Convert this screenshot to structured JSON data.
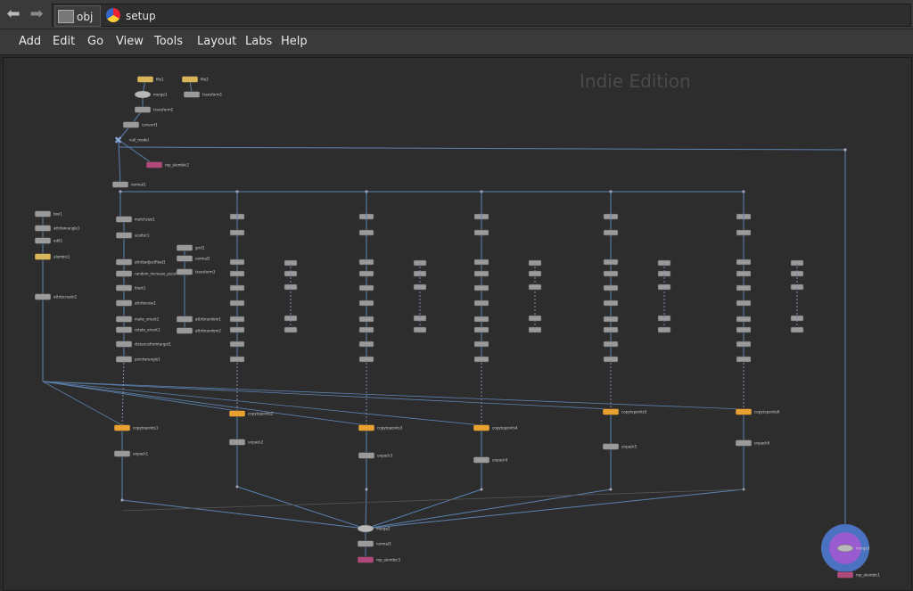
{
  "pathbar": {
    "back_icon": "left-arrow-icon",
    "forward_icon": "right-arrow-icon",
    "crumbs": [
      {
        "label": "obj",
        "icon": "object-network-icon"
      },
      {
        "label": "setup",
        "icon": "geometry-object-icon"
      }
    ]
  },
  "menu": [
    "Add",
    "Edit",
    "Go",
    "View",
    "Tools",
    "Layout",
    "Labs",
    "Help"
  ],
  "network": {
    "watermark": "Indie Edition",
    "colors": {
      "wire": "#5b82b0",
      "node": "#9a9a9a",
      "file": "#d8b45a",
      "copy": "#e8a030",
      "rop": "#b04a7a",
      "highlight": "#4a72c0",
      "merge_glow": "#9a5ad0"
    },
    "nodes": [
      {
        "name": "file1",
        "kind": "file"
      },
      {
        "name": "file2",
        "kind": "file"
      },
      {
        "name": "merge1",
        "kind": "merge"
      },
      {
        "name": "transform1",
        "kind": "sop"
      },
      {
        "name": "transform2",
        "kind": "sop"
      },
      {
        "name": "convert1",
        "kind": "sop"
      },
      {
        "name": "null_model",
        "kind": "null"
      },
      {
        "name": "rop_alembic2",
        "kind": "rop"
      },
      {
        "name": "normal1",
        "kind": "sop"
      },
      {
        "name": "box1",
        "kind": "sop"
      },
      {
        "name": "attribwrangle1",
        "kind": "sop"
      },
      {
        "name": "edit1",
        "kind": "sop"
      },
      {
        "name": "alembic1",
        "kind": "file"
      },
      {
        "name": "attribcreate1",
        "kind": "sop"
      },
      {
        "name": "matchsize1",
        "kind": "sop"
      },
      {
        "name": "scatter1",
        "kind": "sop"
      },
      {
        "name": "attribadjustfloat1",
        "kind": "sop"
      },
      {
        "name": "random_increase_pscale1",
        "kind": "sop"
      },
      {
        "name": "blast1",
        "kind": "sop"
      },
      {
        "name": "attribnoise1",
        "kind": "sop"
      },
      {
        "name": "make_orient1",
        "kind": "sop"
      },
      {
        "name": "rotate_orient1",
        "kind": "sop"
      },
      {
        "name": "distancefromtarget1",
        "kind": "sop"
      },
      {
        "name": "pointwrangle1",
        "kind": "sop"
      },
      {
        "name": "grid1",
        "kind": "sop"
      },
      {
        "name": "normal2",
        "kind": "sop"
      },
      {
        "name": "transform3",
        "kind": "sop"
      },
      {
        "name": "attribrandom1",
        "kind": "sop"
      },
      {
        "name": "attribrandom2",
        "kind": "sop"
      },
      {
        "name": "copytopoints1",
        "kind": "copy"
      },
      {
        "name": "copytopoints2",
        "kind": "copy"
      },
      {
        "name": "copytopoints3",
        "kind": "copy"
      },
      {
        "name": "copytopoints4",
        "kind": "copy"
      },
      {
        "name": "copytopoints5",
        "kind": "copy"
      },
      {
        "name": "copytopoints6",
        "kind": "copy"
      },
      {
        "name": "unpack1",
        "kind": "sop"
      },
      {
        "name": "unpack2",
        "kind": "sop"
      },
      {
        "name": "unpack3",
        "kind": "sop"
      },
      {
        "name": "unpack4",
        "kind": "sop"
      },
      {
        "name": "unpack5",
        "kind": "sop"
      },
      {
        "name": "unpack6",
        "kind": "sop"
      },
      {
        "name": "merge2",
        "kind": "merge"
      },
      {
        "name": "normal3",
        "kind": "sop"
      },
      {
        "name": "rop_alembic3",
        "kind": "rop"
      },
      {
        "name": "merge3",
        "kind": "merge"
      },
      {
        "name": "rop_alembic1",
        "kind": "rop"
      }
    ]
  }
}
